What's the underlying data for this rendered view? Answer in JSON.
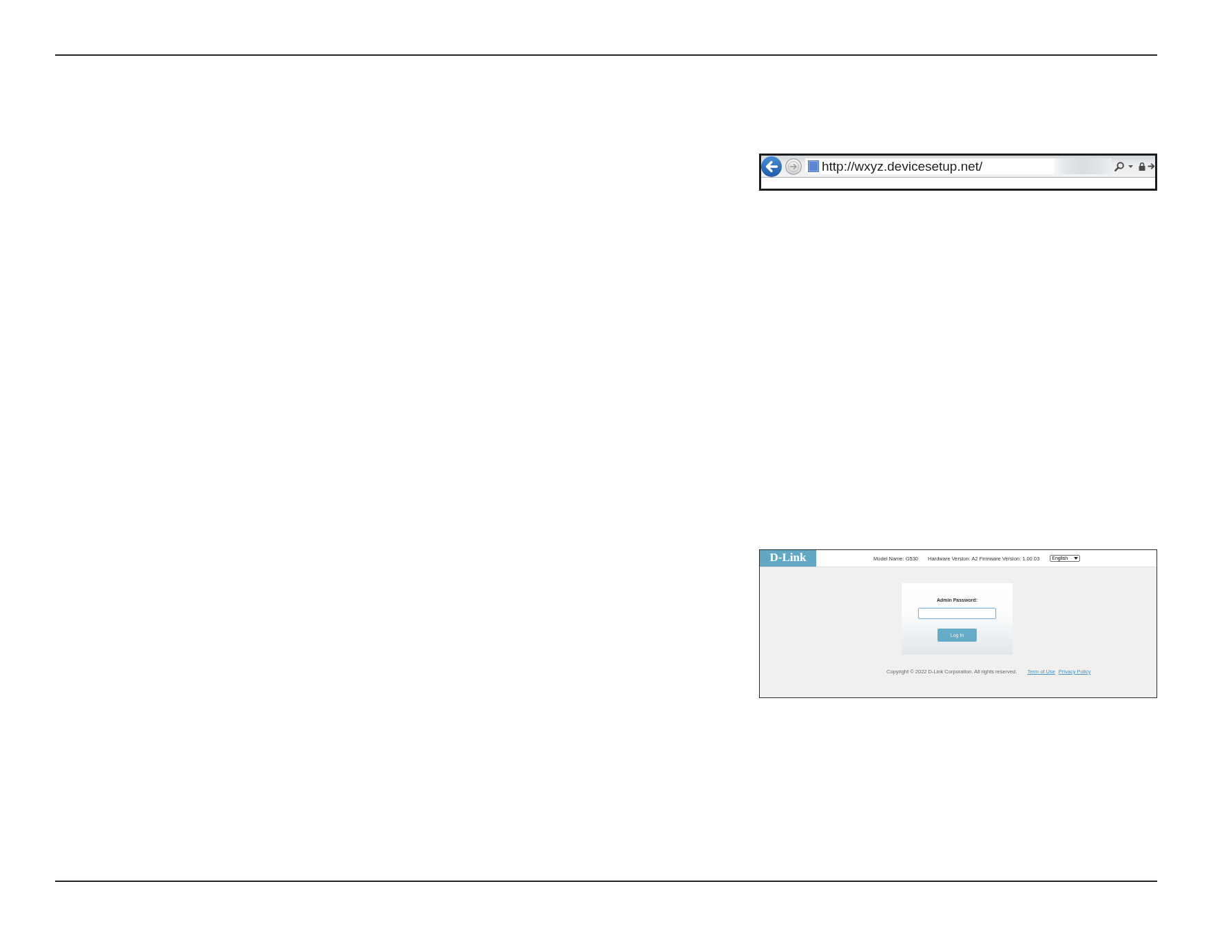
{
  "browser_bar": {
    "url": "http://wxyz.devicesetup.net/"
  },
  "login_page": {
    "logo": "D-Link",
    "model_name": "Model Name: G530",
    "version_info": "Hardware Version: A2 Firmware Version: 1.00.03",
    "language": "English",
    "password_label": "Admin Password:",
    "login_button": "Log In",
    "copyright": "Copyright © 2022 D-Link Corporation. All rights reserved.",
    "footer_links": [
      "Term of Use",
      "Privacy Policy"
    ]
  }
}
